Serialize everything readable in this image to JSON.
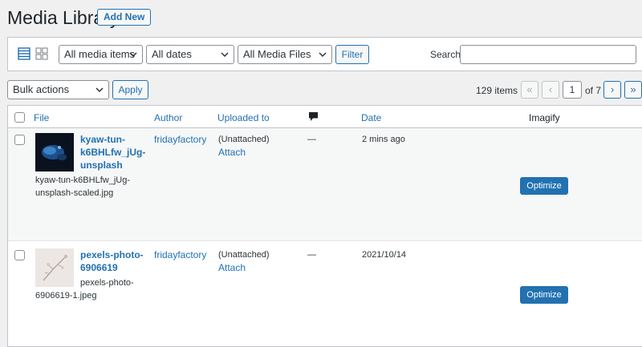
{
  "page": {
    "title": "Media Library",
    "add_new": "Add New"
  },
  "filters": {
    "media_type": "All media items",
    "dates": "All dates",
    "media_files": "All Media Files",
    "filter_button": "Filter",
    "search_label": "Search",
    "search_value": ""
  },
  "bulk": {
    "action": "Bulk actions",
    "apply": "Apply"
  },
  "pagination": {
    "count": "129 items",
    "first": "«",
    "prev": "‹",
    "current": "1",
    "of_total": "of 7",
    "next": "›",
    "last": "»"
  },
  "table": {
    "headers": {
      "file": "File",
      "author": "Author",
      "uploaded_to": "Uploaded to",
      "date": "Date",
      "imagify": "Imagify"
    },
    "rows": [
      {
        "title_l1": "kyaw-tun-",
        "title_l2": "k6BHLfw_jUg-",
        "title_l3": "unsplash",
        "filename_l1": "kyaw-tun-k6BHLfw_jUg-",
        "filename_l2": "unsplash-scaled.jpg",
        "author": "fridayfactory",
        "uploaded": "(Unattached)",
        "attach": "Attach",
        "comments": "—",
        "date": "2 mins ago",
        "optimize": "Optimize"
      },
      {
        "title_l1": "pexels-photo-",
        "title_l2": "6906619",
        "filename_l1": "pexels-photo-",
        "filename_l2": "6906619-1.jpeg",
        "author": "fridayfactory",
        "uploaded": "(Unattached)",
        "attach": "Attach",
        "comments": "—",
        "date": "2021/10/14",
        "optimize": "Optimize"
      }
    ]
  },
  "colors": {
    "accent": "#2271b1",
    "background": "#f0f0f1",
    "border": "#c3c4c7"
  }
}
